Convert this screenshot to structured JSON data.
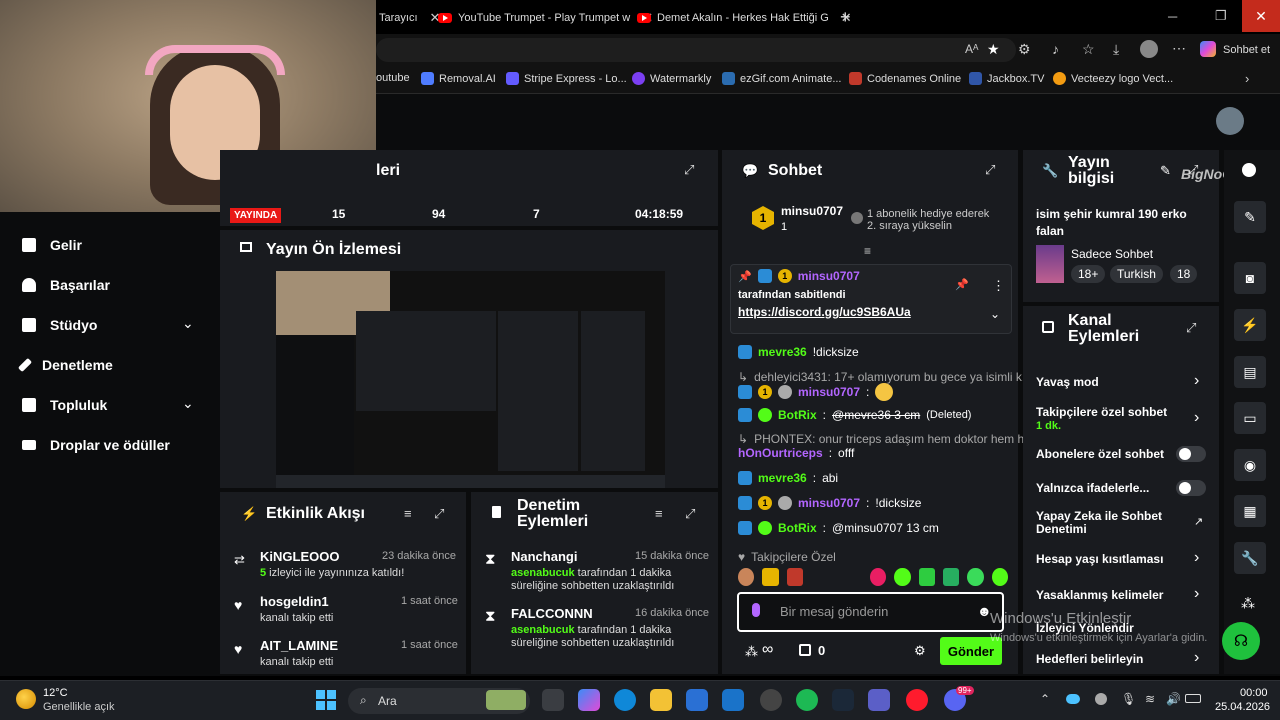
{
  "browser": {
    "tabs": [
      {
        "label": "Tarayıcı"
      },
      {
        "label": "YouTube Trumpet - Play Trumpet w"
      },
      {
        "label": "Demet Akalın - Herkes Hak Ettiği G"
      }
    ],
    "new_tab": "+",
    "copilot_label": "Sohbet et",
    "bookmarks": [
      "outube",
      "Removal.AI",
      "Stripe Express - Lo...",
      "Watermarkly",
      "ezGif.com Animate...",
      "Codenames Online",
      "Jackbox.TV",
      "Vecteezy logo Vect..."
    ]
  },
  "sidebar": {
    "items": [
      {
        "label": "Gelir",
        "icon": "dollar-icon"
      },
      {
        "label": "Başarılar",
        "icon": "trophy-icon"
      },
      {
        "label": "Stüdyo",
        "icon": "studio-icon",
        "chevron": "⌄"
      },
      {
        "label": "Denetleme",
        "icon": "wrench-icon"
      },
      {
        "label": "Topluluk",
        "icon": "community-icon",
        "chevron": "⌄"
      },
      {
        "label": "Droplar ve ödüller",
        "icon": "drops-icon"
      }
    ]
  },
  "stats": {
    "title": "leri",
    "live_label": "YAYINDA",
    "values": [
      "15",
      "94",
      "7",
      "04:18:59"
    ]
  },
  "preview": {
    "title": "Yayın Ön İzlemesi"
  },
  "activity": {
    "title": "Etkinlik Akışı",
    "items": [
      {
        "name": "KiNGLEOOO",
        "time": "23 dakika önce",
        "count": "5",
        "desc": " izleyici ile yayınınıza katıldı!"
      },
      {
        "name": "hosgeldin1",
        "time": "1 saat önce",
        "desc": "kanalı takip etti"
      },
      {
        "name": "AIT_LAMINE",
        "time": "1 saat önce",
        "desc": "kanalı takip etti"
      }
    ]
  },
  "moderation": {
    "title": "Denetim Eylemleri",
    "items": [
      {
        "name": "Nanchangi",
        "time": "15 dakika önce",
        "by": "asenabucuk",
        "desc": " tarafından 1 dakika süreliğine sohbetten uzaklaştırıldı"
      },
      {
        "name": "FALCCONNN",
        "time": "16 dakika önce",
        "by": "asenabucuk",
        "desc": " tarafından 1 dakika süreliğine sohbetten uzaklaştırıldı"
      }
    ]
  },
  "chat": {
    "title": "Sohbet",
    "top_user": "minsu0707",
    "top_rank": "1",
    "top_count": "1",
    "sub_gift": "1 abonelik hediye ederek 2. sıraya yükselin",
    "pinned_user": "minsu0707",
    "pinned_by": "tarafından sabitlendi",
    "pinned_link": "https://discord.gg/uc9SB6AUa",
    "messages": [
      {
        "user": "mevre36",
        "text": " !dicksize",
        "color": "#53fc18"
      },
      {
        "reply": "dehleyici3431: 17+ olamıyorum bu gece ya isimli k..."
      },
      {
        "user": "minsu0707",
        "text": "",
        "color": "#b366ff"
      },
      {
        "user": "BotRix",
        "text": " @mevre36 3 cm",
        "deleted": "(Deleted)",
        "color": "#53fc18"
      },
      {
        "reply": "PHONTEX: onur triceps adaşım hem doktor hem h..."
      },
      {
        "user": "hOnOurtriceps",
        "text": " offf",
        "color": "#b366ff"
      },
      {
        "user": "mevre36",
        "text": " abi",
        "color": "#53fc18"
      },
      {
        "user": "minsu0707",
        "text": " !dicksize",
        "color": "#b366ff"
      },
      {
        "user": "BotRix",
        "text": " @minsu0707 13 cm",
        "color": "#53fc18"
      }
    ],
    "followers_only": "Takipçilere Özel",
    "placeholder": "Bir mesaj gönderin",
    "infinity": "∞",
    "zero": "0",
    "send": "Gönder"
  },
  "stream_info": {
    "title": "Yayın bilgisi",
    "stream_title": "isim şehir kumral 190 erko falan",
    "category": "Sadece Sohbet",
    "tags": [
      "18+",
      "Turkish",
      "18"
    ]
  },
  "channel_actions": {
    "title": "Kanal Eylemleri",
    "items": [
      {
        "label": "Yavaş mod",
        "type": "arrow"
      },
      {
        "label": "Takipçilere özel sohbet",
        "sub": "1 dk.",
        "type": "arrow"
      },
      {
        "label": "Abonelere özel sohbet",
        "type": "toggle"
      },
      {
        "label": "Yalnızca ifadelerle...",
        "type": "toggle"
      },
      {
        "label": "Yapay Zeka ile Sohbet Denetimi",
        "type": "ext"
      },
      {
        "label": "Hesap yaşı kısıtlaması",
        "type": "arrow"
      },
      {
        "label": "Yasaklanmış kelimeler",
        "type": "arrow"
      },
      {
        "label": "İzleyici Yönlendir",
        "type": "none"
      },
      {
        "label": "Hedefleri belirleyin",
        "type": "arrow"
      }
    ]
  },
  "watermark": {
    "line1": "Windows'u Etkinleştir",
    "line2": "Windows'u etkinleştirmek için Ayarlar'a gidin."
  },
  "brand": "BigNoGame",
  "taskbar": {
    "temp": "12°C",
    "weather": "Genellikle açık",
    "search": "Ara",
    "time": "00:00",
    "date": "25.04.2026",
    "badge": "99+"
  },
  "colors": {
    "accent": "#53fc18",
    "live": "#e91916",
    "mention": "#b366ff"
  }
}
